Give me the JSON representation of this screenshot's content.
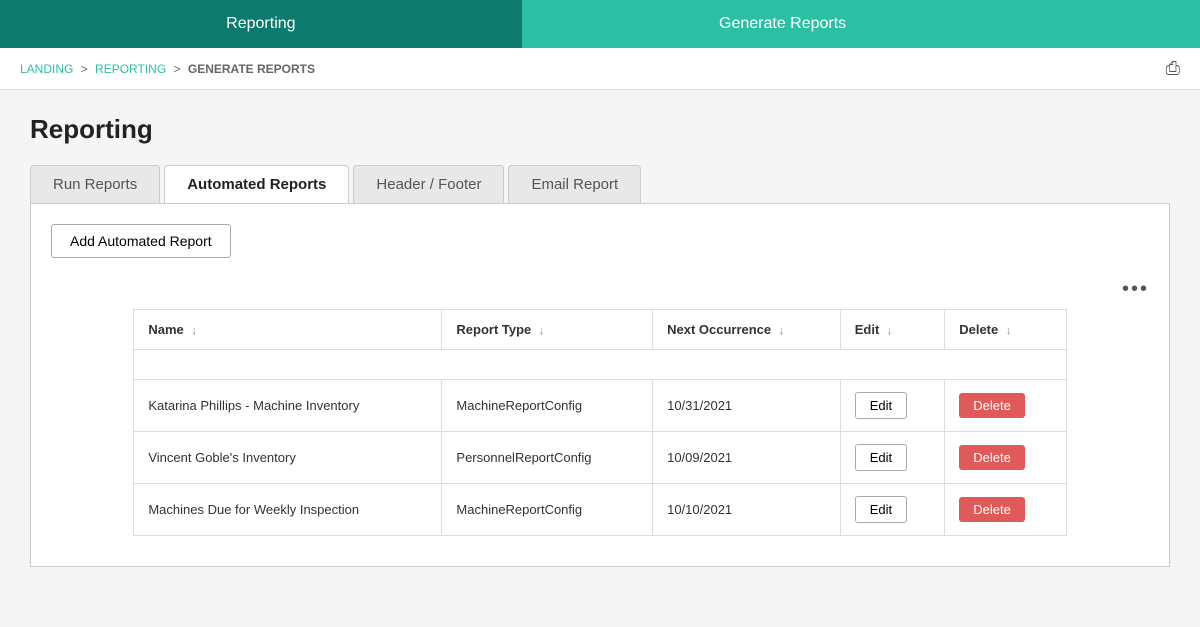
{
  "topNav": {
    "items": [
      {
        "id": "reporting",
        "label": "Reporting",
        "state": "active"
      },
      {
        "id": "generate-reports",
        "label": "Generate Reports",
        "state": "secondary"
      }
    ]
  },
  "breadcrumb": {
    "items": [
      {
        "label": "LANDING",
        "link": true
      },
      {
        "label": "REPORTING",
        "link": true
      },
      {
        "label": "GENERATE REPORTS",
        "link": false
      }
    ],
    "separator": ">"
  },
  "pageTitle": "Reporting",
  "tabs": [
    {
      "id": "run-reports",
      "label": "Run Reports",
      "active": false
    },
    {
      "id": "automated-reports",
      "label": "Automated Reports",
      "active": true
    },
    {
      "id": "header-footer",
      "label": "Header / Footer",
      "active": false
    },
    {
      "id": "email-report",
      "label": "Email Report",
      "active": false
    }
  ],
  "addButtonLabel": "Add Automated Report",
  "threeDots": "•••",
  "table": {
    "columns": [
      {
        "id": "name",
        "label": "Name"
      },
      {
        "id": "report-type",
        "label": "Report Type"
      },
      {
        "id": "next-occurrence",
        "label": "Next Occurrence"
      },
      {
        "id": "edit",
        "label": "Edit"
      },
      {
        "id": "delete",
        "label": "Delete"
      }
    ],
    "rows": [
      {
        "name": "Katarina Phillips - Machine Inventory",
        "reportType": "MachineReportConfig",
        "nextOccurrence": "10/31/2021",
        "editLabel": "Edit",
        "deleteLabel": "Delete"
      },
      {
        "name": "Vincent Goble's Inventory",
        "reportType": "PersonnelReportConfig",
        "nextOccurrence": "10/09/2021",
        "editLabel": "Edit",
        "deleteLabel": "Delete"
      },
      {
        "name": "Machines Due for Weekly Inspection",
        "reportType": "MachineReportConfig",
        "nextOccurrence": "10/10/2021",
        "editLabel": "Edit",
        "deleteLabel": "Delete"
      }
    ]
  }
}
